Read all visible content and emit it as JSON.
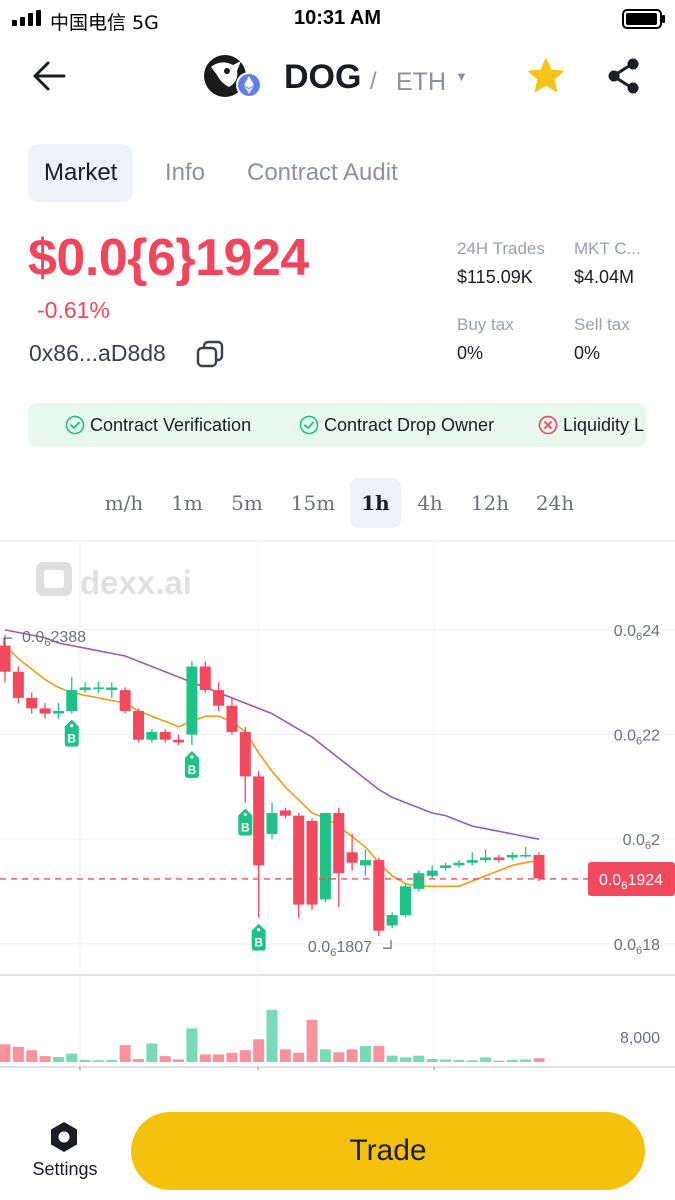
{
  "status_bar": {
    "carrier": "中国电信  5G",
    "time": "10:31 AM"
  },
  "header": {
    "base": "DOG",
    "separator": "/",
    "quote": "ETH",
    "caret": "▼",
    "icons": [
      "back-arrow-icon",
      "token-logo",
      "ethereum-icon",
      "star-icon",
      "share-icon"
    ],
    "star_color": "#f5c518"
  },
  "tabs": [
    {
      "label": "Market",
      "active": true
    },
    {
      "label": "Info",
      "active": false
    },
    {
      "label": "Contract Audit",
      "active": false
    }
  ],
  "token": {
    "price": "$0.0{6}1924",
    "change": "-0.61%",
    "address": "0x86...aD8d8",
    "negative_color": "#f0455d"
  },
  "stats": [
    {
      "label": "24H Trades",
      "value": "$115.09K"
    },
    {
      "label": "MKT C...",
      "value": "$4.04M"
    },
    {
      "label": "Buy tax",
      "value": "0%"
    },
    {
      "label": "Sell tax",
      "value": "0%"
    }
  ],
  "audit": [
    {
      "label": "Contract Verification",
      "status": "pass"
    },
    {
      "label": "Contract Drop Owner",
      "status": "pass"
    },
    {
      "label": "Liquidity L",
      "status": "fail"
    }
  ],
  "timeframes": [
    "m/h",
    "1m",
    "5m",
    "15m",
    "1h",
    "4h",
    "12h",
    "24h"
  ],
  "active_timeframe": "1h",
  "chart_data": {
    "type": "candlestick",
    "watermark": "dexx.ai",
    "y_ticks": [
      {
        "label_main": "0.0",
        "label_sub": "6",
        "label_tail": "24",
        "value": 2.4e-07
      },
      {
        "label_main": "0.0",
        "label_sub": "6",
        "label_tail": "22",
        "value": 2.2e-07
      },
      {
        "label_main": "0.0",
        "label_sub": "6",
        "label_tail": "2",
        "value": 2e-07
      },
      {
        "label_main": "0.0",
        "label_sub": "6",
        "label_tail": "18",
        "value": 1.8e-07
      }
    ],
    "ylim": [
      1.75e-07,
      2.545e-07
    ],
    "current_price": {
      "label_main": "0.0",
      "label_sub": "6",
      "label_tail": "1924",
      "value": 1.924e-07
    },
    "high_marker": {
      "label_main": "0.0",
      "label_sub": "6",
      "label_tail": "2388",
      "value": 2.388e-07
    },
    "low_marker": {
      "label_main": "0.0",
      "label_sub": "6",
      "label_tail": "1807",
      "value": 1.807e-07
    },
    "volume_tick": "8,000",
    "volume_max": 9500,
    "up_color": "#1ec186",
    "down_color": "#f2495e",
    "ma_fast_color": "#f39c12",
    "ma_slow_color": "#9b59b6",
    "buy_marker_label": "B",
    "buy_marker_indices": [
      5,
      14,
      18,
      19
    ],
    "candles": [
      {
        "o": 2.37,
        "c": 2.32,
        "h": 2.39,
        "l": 2.3,
        "v": 2100
      },
      {
        "o": 2.32,
        "c": 2.27,
        "h": 2.33,
        "l": 2.26,
        "v": 1800
      },
      {
        "o": 2.27,
        "c": 2.25,
        "h": 2.28,
        "l": 2.24,
        "v": 1400
      },
      {
        "o": 2.25,
        "c": 2.24,
        "h": 2.26,
        "l": 2.23,
        "v": 700
      },
      {
        "o": 2.24,
        "c": 2.245,
        "h": 2.26,
        "l": 2.23,
        "v": 600
      },
      {
        "o": 2.245,
        "c": 2.285,
        "h": 2.31,
        "l": 2.24,
        "v": 1000
      },
      {
        "o": 2.285,
        "c": 2.29,
        "h": 2.3,
        "l": 2.28,
        "v": 250
      },
      {
        "o": 2.29,
        "c": 2.29,
        "h": 2.3,
        "l": 2.28,
        "v": 200
      },
      {
        "o": 2.285,
        "c": 2.29,
        "h": 2.3,
        "l": 2.27,
        "v": 250
      },
      {
        "o": 2.285,
        "c": 2.245,
        "h": 2.29,
        "l": 2.24,
        "v": 2000
      },
      {
        "o": 2.245,
        "c": 2.19,
        "h": 2.25,
        "l": 2.185,
        "v": 350
      },
      {
        "o": 2.19,
        "c": 2.205,
        "h": 2.21,
        "l": 2.185,
        "v": 2200
      },
      {
        "o": 2.205,
        "c": 2.19,
        "h": 2.21,
        "l": 2.185,
        "v": 700
      },
      {
        "o": 2.19,
        "c": 2.185,
        "h": 2.2,
        "l": 2.18,
        "v": 300
      },
      {
        "o": 2.2,
        "c": 2.33,
        "h": 2.34,
        "l": 2.18,
        "v": 4000
      },
      {
        "o": 2.33,
        "c": 2.285,
        "h": 2.34,
        "l": 2.28,
        "v": 900
      },
      {
        "o": 2.285,
        "c": 2.255,
        "h": 2.3,
        "l": 2.245,
        "v": 900
      },
      {
        "o": 2.255,
        "c": 2.205,
        "h": 2.27,
        "l": 2.2,
        "v": 1100
      },
      {
        "o": 2.205,
        "c": 2.12,
        "h": 2.215,
        "l": 2.07,
        "v": 1400
      },
      {
        "o": 2.12,
        "c": 1.95,
        "h": 2.13,
        "l": 1.85,
        "v": 2700
      },
      {
        "o": 2.01,
        "c": 2.05,
        "h": 2.07,
        "l": 2.0,
        "v": 6200
      },
      {
        "o": 2.055,
        "c": 2.045,
        "h": 2.06,
        "l": 2.04,
        "v": 1500
      },
      {
        "o": 2.045,
        "c": 1.875,
        "h": 2.05,
        "l": 1.85,
        "v": 1100
      },
      {
        "o": 2.035,
        "c": 1.875,
        "h": 2.04,
        "l": 1.865,
        "v": 5000
      },
      {
        "o": 1.885,
        "c": 2.05,
        "h": 2.05,
        "l": 1.88,
        "v": 1500
      },
      {
        "o": 2.05,
        "c": 1.935,
        "h": 2.06,
        "l": 1.87,
        "v": 1150
      },
      {
        "o": 1.975,
        "c": 1.955,
        "h": 2.01,
        "l": 1.94,
        "v": 1500
      },
      {
        "o": 1.95,
        "c": 1.96,
        "h": 1.98,
        "l": 1.93,
        "v": 1900
      },
      {
        "o": 1.96,
        "c": 1.825,
        "h": 1.965,
        "l": 1.815,
        "v": 1900
      },
      {
        "o": 1.835,
        "c": 1.855,
        "h": 1.86,
        "l": 1.83,
        "v": 750
      },
      {
        "o": 1.855,
        "c": 1.91,
        "h": 1.915,
        "l": 1.85,
        "v": 550
      },
      {
        "o": 1.905,
        "c": 1.935,
        "h": 1.94,
        "l": 1.9,
        "v": 750
      },
      {
        "o": 1.93,
        "c": 1.94,
        "h": 1.95,
        "l": 1.925,
        "v": 350
      },
      {
        "o": 1.945,
        "c": 1.95,
        "h": 1.955,
        "l": 1.94,
        "v": 300
      },
      {
        "o": 1.95,
        "c": 1.955,
        "h": 1.96,
        "l": 1.945,
        "v": 250
      },
      {
        "o": 1.955,
        "c": 1.96,
        "h": 1.975,
        "l": 1.95,
        "v": 200
      },
      {
        "o": 1.96,
        "c": 1.965,
        "h": 1.98,
        "l": 1.955,
        "v": 550
      },
      {
        "o": 1.965,
        "c": 1.96,
        "h": 1.97,
        "l": 1.955,
        "v": 150
      },
      {
        "o": 1.965,
        "c": 1.97,
        "h": 1.975,
        "l": 1.96,
        "v": 250
      },
      {
        "o": 1.97,
        "c": 1.97,
        "h": 1.985,
        "l": 1.965,
        "v": 300
      },
      {
        "o": 1.97,
        "c": 1.925,
        "h": 1.975,
        "l": 1.92,
        "v": 450
      }
    ],
    "ma_fast": [
      2.37,
      2.345,
      2.325,
      2.305,
      2.29,
      2.28,
      2.275,
      2.27,
      2.265,
      2.26,
      2.245,
      2.235,
      2.225,
      2.215,
      2.225,
      2.235,
      2.235,
      2.225,
      2.205,
      2.165,
      2.13,
      2.1,
      2.075,
      2.05,
      2.04,
      2.025,
      2.005,
      1.985,
      1.955,
      1.93,
      1.915,
      1.91,
      1.91,
      1.91,
      1.91,
      1.92,
      1.93,
      1.94,
      1.95,
      1.955,
      1.96
    ],
    "ma_slow": [
      2.4,
      2.395,
      2.39,
      2.385,
      2.375,
      2.37,
      2.365,
      2.36,
      2.355,
      2.35,
      2.34,
      2.33,
      2.32,
      2.31,
      2.3,
      2.29,
      2.28,
      2.27,
      2.26,
      2.25,
      2.24,
      2.225,
      2.21,
      2.195,
      2.175,
      2.155,
      2.135,
      2.115,
      2.095,
      2.08,
      2.07,
      2.06,
      2.05,
      2.045,
      2.035,
      2.025,
      2.02,
      2.015,
      2.01,
      2.005,
      2.0
    ],
    "price_unit": 1e-07
  },
  "bottom": {
    "settings_label": "Settings",
    "trade_label": "Trade",
    "trade_color": "#f4c20d"
  }
}
